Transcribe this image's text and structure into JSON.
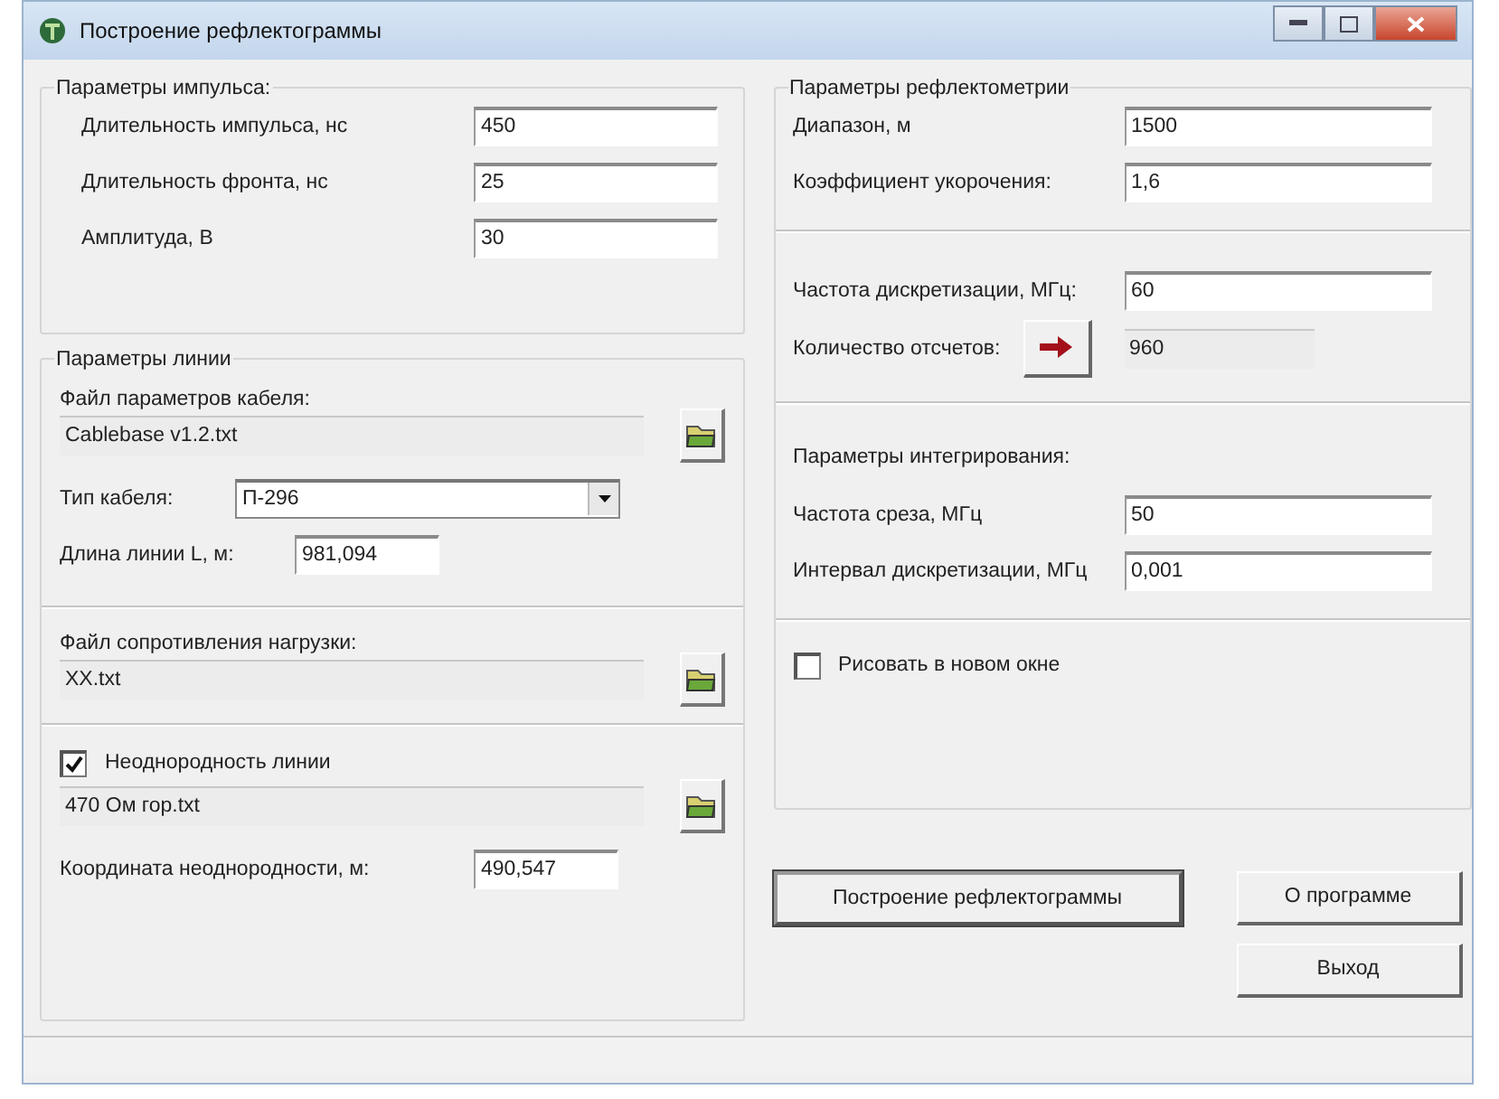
{
  "window": {
    "title": "Построение рефлектограммы"
  },
  "pulse_params": {
    "title": "Параметры импульса:",
    "fields": [
      {
        "label": "Длительность импульса, нс",
        "value": "450"
      },
      {
        "label": "Длительность фронта, нс",
        "value": "25"
      },
      {
        "label": "Амплитуда, В",
        "value": "30"
      }
    ]
  },
  "line_params": {
    "title": "Параметры линии",
    "cable_file": {
      "label": "Файл параметров кабеля:",
      "value": "Cablebase v1.2.txt"
    },
    "cable_type": {
      "label": "Тип кабеля:",
      "value": "П-296"
    },
    "line_length": {
      "label": "Длина линии L, м:",
      "value": "981,094"
    },
    "load_file": {
      "label": "Файл сопротивления нагрузки:",
      "value": "XX.txt"
    },
    "inhomogeneity": {
      "label": "Неоднородность линии",
      "checked": true,
      "file": "470 Ом гор.txt",
      "coordinate_label": "Координата неоднородности, м:",
      "coordinate": "490,547"
    }
  },
  "reflectometry": {
    "title": "Параметры рефлектометрии",
    "range": {
      "label": "Диапазон, м",
      "value": "1500"
    },
    "shortening": {
      "label": "Коэффициент укорочения:",
      "value": "1,6"
    },
    "sampling_rate": {
      "label": "Частота дискретизации, МГц:",
      "value": "60"
    },
    "samples": {
      "label": "Количество отсчетов:",
      "value": "960"
    },
    "integration_title": "Параметры интегрирования:",
    "cutoff": {
      "label": "Частота среза, МГц",
      "value": "50"
    },
    "interval": {
      "label": "Интервал дискретизации, МГц",
      "value": "0,001"
    },
    "new_window": {
      "label": "Рисовать в новом окне",
      "checked": false
    }
  },
  "buttons": [
    {
      "label": "Построение рефлектограммы",
      "default": true
    },
    {
      "label": "О программе",
      "default": false
    },
    {
      "label": "Выход",
      "default": false
    }
  ]
}
